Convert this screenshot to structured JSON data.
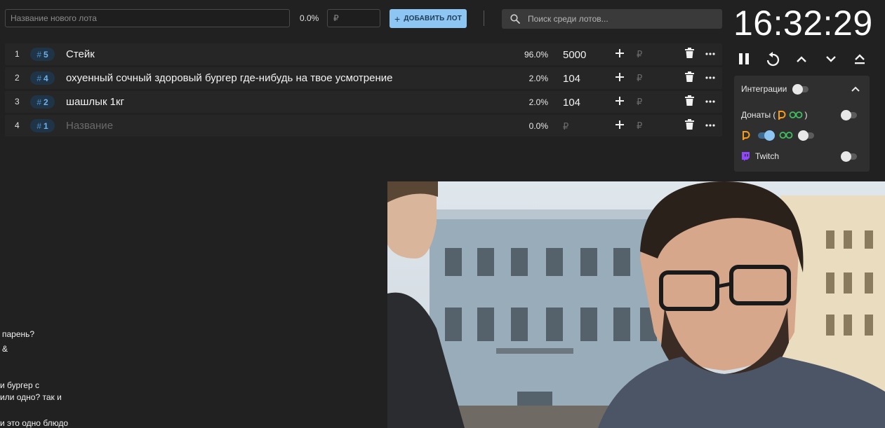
{
  "top_bar": {
    "new_lot_placeholder": "Название нового лота",
    "percent": "0.0%",
    "amount_placeholder": "₽",
    "add_button_label": "ДОБАВИТЬ ЛОТ",
    "search_placeholder": "Поиск среди лотов..."
  },
  "lots": [
    {
      "index": "1",
      "id": "5",
      "name": "Стейк",
      "percent": "96.0%",
      "amount": "5000",
      "currency": "₽"
    },
    {
      "index": "2",
      "id": "4",
      "name": "охуенный сочный здоровый бургер где-нибудь на твое усмотрение",
      "percent": "2.0%",
      "amount": "104",
      "currency": "₽"
    },
    {
      "index": "3",
      "id": "2",
      "name": "шашлык 1кг",
      "percent": "2.0%",
      "amount": "104",
      "currency": "₽"
    },
    {
      "index": "4",
      "id": "1",
      "name": "Название",
      "percent": "0.0%",
      "amount": "₽",
      "currency": "₽"
    }
  ],
  "timer": {
    "time": "16:32:29"
  },
  "integrations": {
    "title": "Интеграции",
    "donations_label": "Донаты (",
    "donations_close": ")",
    "twitch_label": "Twitch",
    "toggles": {
      "integrations": false,
      "donations": false,
      "da": true,
      "alerts": false,
      "twitch": false
    }
  },
  "chat": {
    "lines": [
      "парень?",
      "&",
      "и бургер с",
      "или одно? так и",
      "и это одно блюдо"
    ]
  },
  "colors": {
    "accent": "#8dc6f2",
    "background": "#212121",
    "row_background": "#262626",
    "badge_background": "#1f3447",
    "twitch": "#9146ff",
    "donation_orange": "#f59c1a",
    "alerts_green": "#3fbf5f"
  },
  "icons": {
    "search": "search-icon",
    "add": "plus-icon",
    "delete": "trash-icon",
    "more": "more-icon",
    "pause": "pause-icon",
    "restart": "restart-icon",
    "up": "chevron-up-icon",
    "down": "chevron-down-icon",
    "eject": "eject-icon"
  }
}
